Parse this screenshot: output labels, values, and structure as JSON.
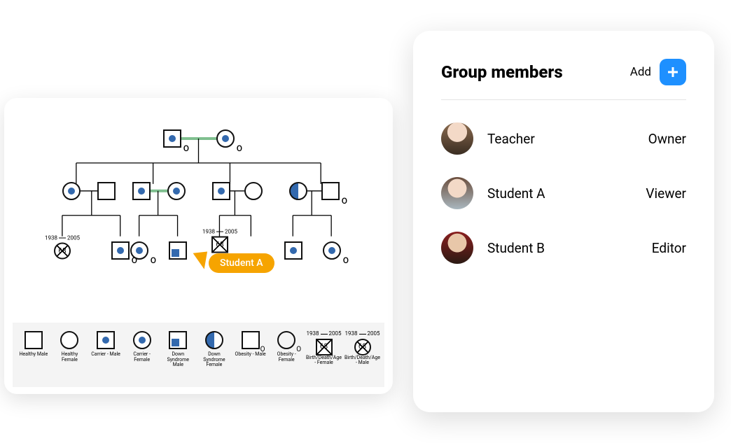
{
  "membersPanel": {
    "title": "Group members",
    "addLabel": "Add",
    "rows": [
      {
        "name": "Teacher",
        "role": "Owner"
      },
      {
        "name": "Student A",
        "role": "Viewer"
      },
      {
        "name": "Student B",
        "role": "Editor"
      }
    ]
  },
  "cursor": {
    "label": "Student A"
  },
  "birthDeath": {
    "born": "1938",
    "died": "2005",
    "age": "68"
  },
  "legend": [
    {
      "label": "Healthy Male"
    },
    {
      "label": "Healthy Female"
    },
    {
      "label": "Carrier - Male"
    },
    {
      "label": "Carrier - Female"
    },
    {
      "label": "Down Syndrome Male"
    },
    {
      "label": "Down Syndrome Female"
    },
    {
      "label": "Obesity - Male"
    },
    {
      "label": "Obesity - Female"
    },
    {
      "label": "Birth/Death/Age - Female"
    },
    {
      "label": "Birth/Death/Age - Male"
    }
  ]
}
